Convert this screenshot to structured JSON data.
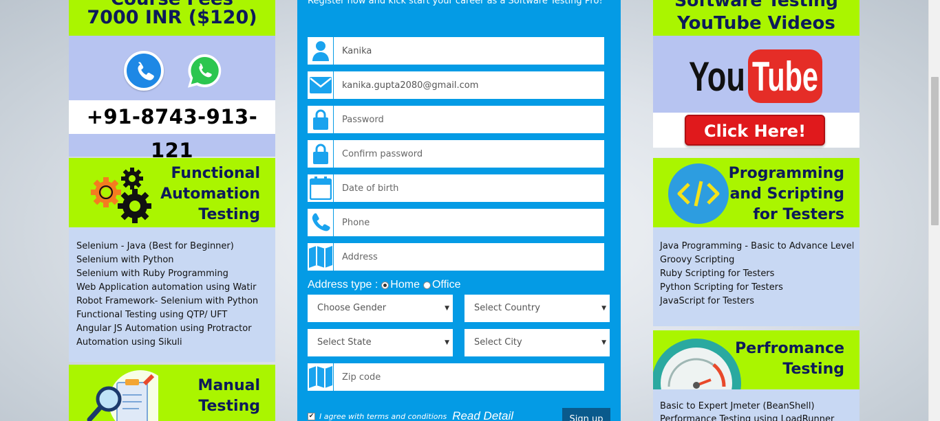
{
  "left": {
    "price_top": "Course Fees",
    "price_main": "7000 INR ($120)",
    "phone": "+91-8743-913-121",
    "functional": {
      "title_lines": [
        "Functional",
        "Automation",
        "Testing"
      ],
      "items": [
        "Selenium - Java (Best for Beginner)",
        "Selenium with Python",
        "Selenium with Ruby Programming",
        "Web Application automation using Watir",
        "Robot Framework- Selenium with Python",
        "Functional Testing using QTP/ UFT",
        "Angular JS Automation using Protractor",
        "Automation using Sikuli"
      ]
    },
    "manual": {
      "title_lines": [
        "Manual",
        "Testing"
      ]
    }
  },
  "form": {
    "intro": "Register now and kick start your career as a Software Testing Pro!",
    "name_value": "Kanika",
    "email_value": "kanika.gupta2080@gmail.com",
    "password_placeholder": "Password",
    "confirm_placeholder": "Confirm password",
    "dob_placeholder": "Date of birth",
    "phone_placeholder": "Phone",
    "address_placeholder": "Address",
    "address_type_label": "Address type :",
    "address_home": "Home",
    "address_office": "Office",
    "gender": "Choose Gender",
    "country": "Select Country",
    "state": "Select State",
    "city": "Select City",
    "zip_placeholder": "Zip code",
    "agree_text": "I agree with terms and conditions",
    "read_detail": "Read Detail",
    "signup": "Sign up"
  },
  "right": {
    "yt_top": "Software Testing",
    "yt_main": "YouTube Videos",
    "click_here": "Click Here!",
    "programming": {
      "title_lines": [
        "Programming",
        "and Scripting",
        "for Testers"
      ],
      "items": [
        "Java Programming - Basic to Advance Level",
        "Groovy Scripting",
        "Ruby Scripting for Testers",
        "Python Scripting for Testers",
        "JavaScript for Testers"
      ]
    },
    "performance": {
      "title_lines": [
        "Perfromance",
        "Testing"
      ],
      "items": [
        "Basic to Expert Jmeter (BeanShell)",
        "Performance Testing using LoadRunner"
      ]
    }
  },
  "colors": {
    "lime": "#aaf500",
    "navy_text": "#0d1a5a",
    "form_blue": "#049be5",
    "icon_blue": "#1aa3ee",
    "youtube_red": "#e0191c"
  },
  "icons": [
    "phone-call-icon",
    "whatsapp-icon",
    "gears-icon",
    "magnifier-clipboard-icon",
    "user-icon",
    "envelope-icon",
    "lock-icon",
    "calendar-icon",
    "phone-handset-icon",
    "map-icon",
    "youtube-logo",
    "code-icon",
    "speed-gauge-icon"
  ]
}
